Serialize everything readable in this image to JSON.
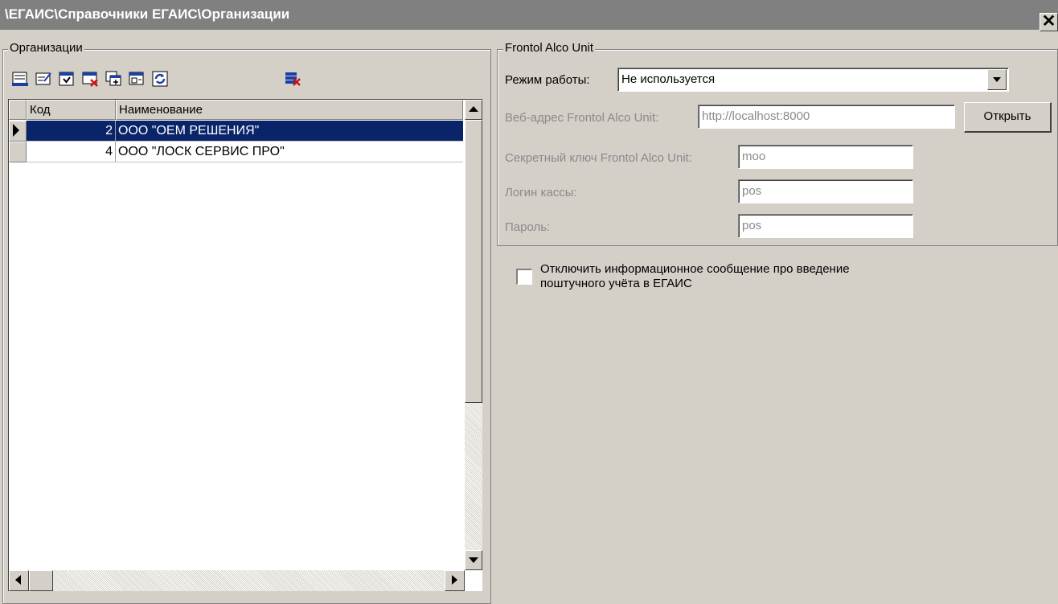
{
  "window": {
    "title": "\\ЕГАИС\\Справочники ЕГАИС\\Организации",
    "close_glyph": "✕"
  },
  "left_panel": {
    "group_title": "Организации",
    "toolbar": [
      {
        "name": "add-record-icon"
      },
      {
        "name": "edit-record-icon"
      },
      {
        "name": "save-record-icon"
      },
      {
        "name": "delete-record-icon"
      },
      {
        "name": "copy-record-icon"
      },
      {
        "name": "find-record-icon"
      },
      {
        "name": "refresh-icon"
      },
      {
        "name": "delete-all-icon"
      }
    ],
    "table": {
      "columns": [
        "Код",
        "Наименование"
      ],
      "rows": [
        {
          "code": "2",
          "name": "ООО \"ОЕМ РЕШЕНИЯ\"",
          "selected": true
        },
        {
          "code": "4",
          "name": "ООО \"ЛОСК СЕРВИС ПРО\"",
          "selected": false
        }
      ]
    }
  },
  "right_panel": {
    "group_title": "Frontol Alco Unit",
    "mode_label": "Режим работы:",
    "mode_value": "Не используется",
    "url_label": "Веб-адрес Frontol Alco Unit:",
    "url_value": "http://localhost:8000",
    "open_button": "Открыть",
    "secret_label": "Секретный ключ  Frontol Alco Unit:",
    "secret_value": "moo",
    "login_label": "Логин кассы:",
    "login_value": "pos",
    "password_label": "Пароль:",
    "password_value": "pos",
    "checkbox_label_line1": "Отключить информационное сообщение про введение",
    "checkbox_label_line2": "поштучного учёта в ЕГАИС",
    "checkbox_checked": false
  },
  "colors": {
    "selection": "#0a246a",
    "face": "#d4d0c8",
    "disabled_text": "#8a8a8a"
  }
}
